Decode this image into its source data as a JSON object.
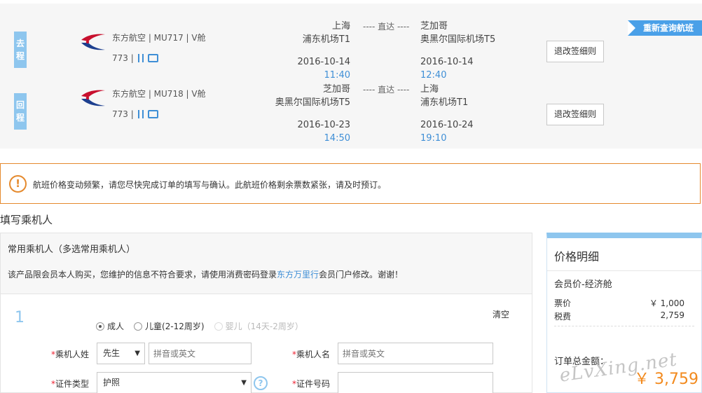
{
  "colors": {
    "accent": "#3f8fd6",
    "tag": "#8ec6ee",
    "warning": "#e58a2e",
    "price": "#f28a1e",
    "required": "#e23"
  },
  "flights": {
    "requery_label": "重新查询航班",
    "rules_label": "退改签细则",
    "outbound": {
      "tag": "去程",
      "airline_line": "东方航空 | MU717 | V舱",
      "plane": "773 |",
      "dep_city": "上海",
      "dep_airport": "浦东机场T1",
      "dep_date": "2016-10-14",
      "dep_time": "11:40",
      "direct": "---- 直达 ----",
      "arr_city": "芝加哥",
      "arr_airport": "奥黑尔国际机场T5",
      "arr_date": "2016-10-14",
      "arr_time": "12:40"
    },
    "return": {
      "tag": "回程",
      "airline_line": "东方航空 | MU718 | V舱",
      "plane": "773 |",
      "dep_city": "芝加哥",
      "dep_airport": "奥黑尔国际机场T5",
      "dep_date": "2016-10-23",
      "dep_time": "14:50",
      "direct": "---- 直达 ----",
      "arr_city": "上海",
      "arr_airport": "浦东机场T1",
      "arr_date": "2016-10-24",
      "arr_time": "19:10"
    }
  },
  "warning": {
    "icon": "!",
    "text": "航班价格变动频繁，请您尽快完成订单的填写与确认。此航班价格剩余票数紧张，请及时预订。"
  },
  "section_title": "填写乘机人",
  "form": {
    "frequent_title": "常用乘机人（多选常用乘机人）",
    "note_before": "该产品限会员本人购买，您维护的信息不符合要求，请使用消费密码登录",
    "note_link": "东方万里行",
    "note_after": "会员门户修改。谢谢！",
    "passenger_number": "1",
    "clear": "清空",
    "types": {
      "adult": "成人",
      "child": "儿童(2-12周岁)",
      "infant": "婴儿（14天-2周岁）"
    },
    "required_mark": "*",
    "surname_label": "乘机人姓",
    "title_select": "先生",
    "surname_placeholder": "拼音或英文",
    "given_label": "乘机人名",
    "given_placeholder": "拼音或英文",
    "id_type_label": "证件类型",
    "id_type_value": "护照",
    "id_number_label": "证件号码",
    "help": "?"
  },
  "price": {
    "title": "价格明细",
    "cabin": "会员价-经济舱",
    "fare_label": "票价",
    "fare_value": "￥ 1,000",
    "tax_label": "税费",
    "tax_value": "2,759",
    "total_label": "订单总金额：",
    "total_value": "￥ 3,759"
  },
  "watermark": "eLvXing.net"
}
